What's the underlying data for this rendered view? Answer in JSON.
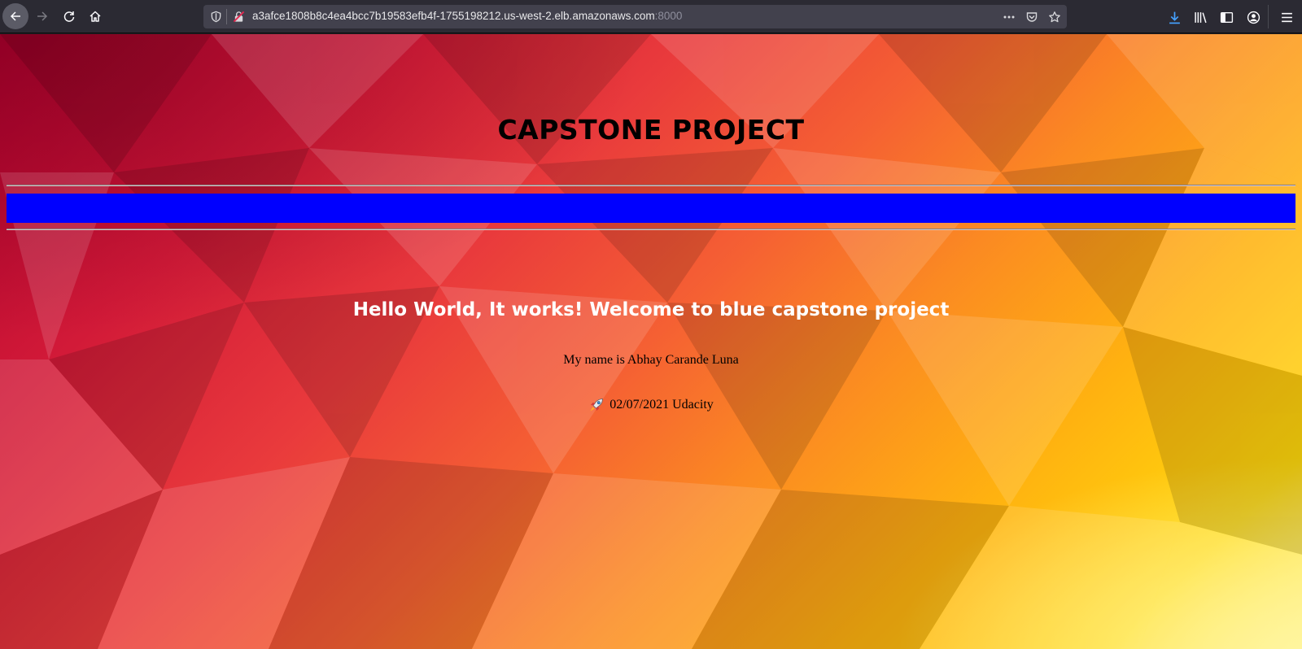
{
  "browser": {
    "url_host": "a3afce1808b8c4ea4bcc7b19583efb4f-1755198212.us-west-2.elb.amazonaws.com",
    "url_port": ":8000",
    "icons": {
      "back": "back-arrow-icon",
      "forward": "forward-arrow-icon",
      "reload": "reload-icon",
      "home": "home-icon",
      "shield": "tracking-protection-shield-icon",
      "lock": "insecure-lock-icon",
      "more": "page-actions-more-icon",
      "pocket": "pocket-icon",
      "star": "bookmark-star-icon",
      "download": "download-icon",
      "library": "library-icon",
      "sidebar": "sidebar-icon",
      "account": "account-icon",
      "menu": "hamburger-menu-icon"
    },
    "colors": {
      "toolbar": "#2b2a33",
      "urlbar": "#42414d",
      "download_accent": "#45a1ff"
    }
  },
  "page": {
    "title": "CAPSTONE PROJECT",
    "greeting": "Hello World, It works! Welcome to blue capstone project",
    "name_line": "My name is Abhay Carande Luna",
    "footer_text": "02/07/2021 Udacity",
    "footer_icon": "rocket-icon",
    "colors": {
      "bar": "#0000ff",
      "greeting": "#ffffff",
      "text": "#000000"
    }
  }
}
